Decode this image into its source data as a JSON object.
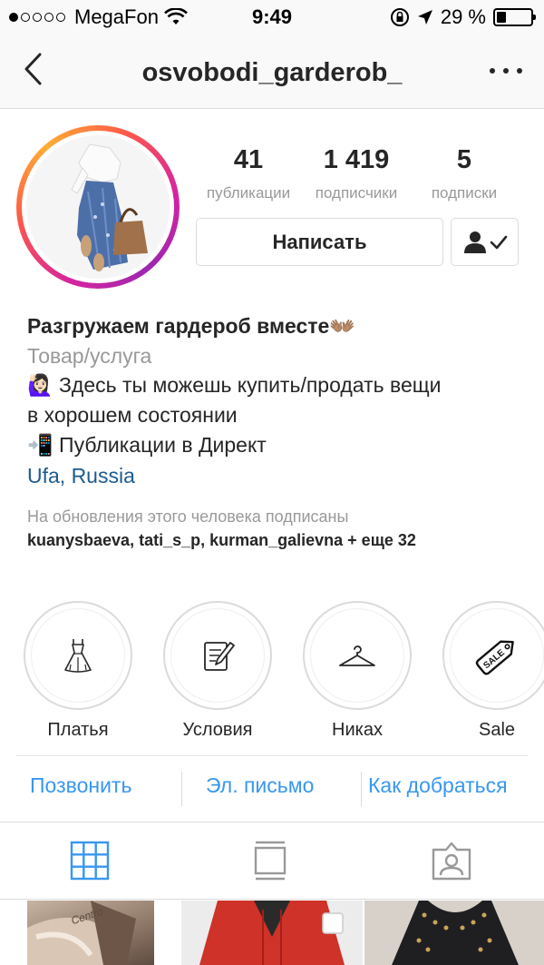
{
  "status_bar": {
    "carrier": "MegaFon",
    "time": "9:49",
    "battery_percent": "29 %",
    "battery_level": 0.29,
    "signal_dots_filled": 1
  },
  "nav": {
    "username": "osvobodi_garderob_",
    "back_icon": "chevron-left-icon",
    "more_icon": "more-icon"
  },
  "profile": {
    "stats": [
      {
        "value": "41",
        "label": "публикации"
      },
      {
        "value": "1 419",
        "label": "подписчики"
      },
      {
        "value": "5",
        "label": "подписки"
      }
    ],
    "message_button": "Написать",
    "follow_icon": "following-check-icon"
  },
  "bio": {
    "name": "Разгружаем гардероб вместе",
    "name_emoji": "👐🏽",
    "category": "Товар/услуга",
    "line1_emoji": "🙋🏻‍♀️",
    "line1": "Здесь ты можешь купить/продать вещи",
    "line2": "в хорошем состоянии",
    "line3_emoji": "📲",
    "line3": "Публикации в Директ",
    "location": "Ufa, Russia"
  },
  "followed_by": {
    "prefix": "На обновления этого человека подписаны",
    "names": "kuanysbaeva, tati_s_p, kurman_galievna",
    "suffix": " + еще 32"
  },
  "highlights": [
    {
      "label": "Платья",
      "icon": "dress-icon"
    },
    {
      "label": "Условия",
      "icon": "document-edit-icon"
    },
    {
      "label": "Никах",
      "icon": "hanger-icon"
    },
    {
      "label": "Sale",
      "icon": "sale-tag-icon",
      "tag_text": "SALE"
    }
  ],
  "contacts": {
    "call": "Позвонить",
    "email": "Эл. письмо",
    "directions": "Как добраться"
  },
  "tabs": [
    {
      "name": "grid",
      "icon": "grid-icon",
      "active": true,
      "color": "#3897f0"
    },
    {
      "name": "feed",
      "icon": "feed-icon",
      "active": false,
      "color": "#999999"
    },
    {
      "name": "tagged",
      "icon": "tagged-icon",
      "active": false,
      "color": "#999999"
    }
  ],
  "thumbnails": {
    "first_brand_text": "Centro"
  },
  "colors": {
    "link": "#3897f0",
    "location": "#1d5b91",
    "muted": "#999999",
    "text": "#262626"
  }
}
